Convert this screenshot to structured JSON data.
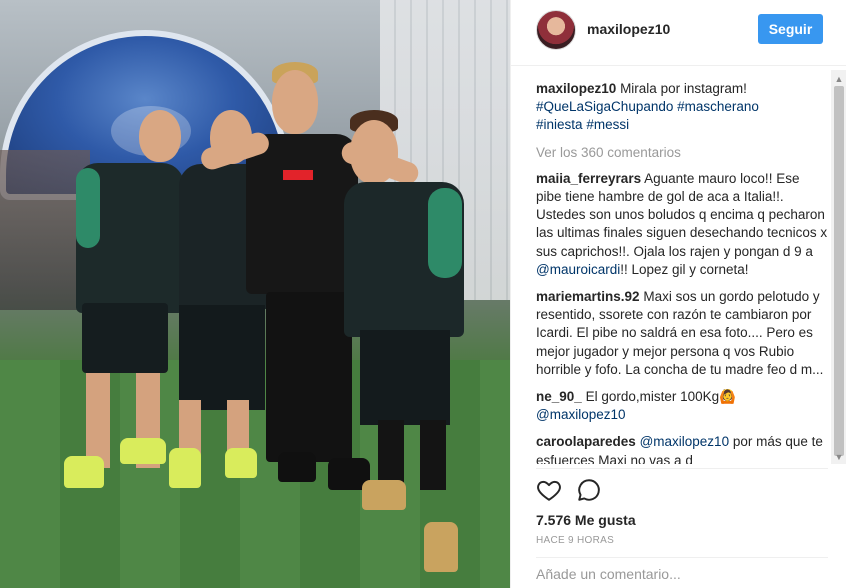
{
  "post": {
    "image_alt": "Four men posing on a football pitch",
    "author": "maxilopez10",
    "follow_label": "Seguir",
    "caption": {
      "user": "maxilopez10",
      "text": "Mirala por instagram!",
      "hashtags": [
        "#QueLaSigaChupando",
        "#mascherano",
        "#iniesta",
        "#messi"
      ]
    },
    "view_all_comments": "Ver los 360 comentarios",
    "comments": [
      {
        "user": "maiia_ferreyrars",
        "text_before": "Aguante mauro loco!! Ese pibe tiene hambre de gol de aca a Italia!!. Ustedes son unos boludos q encima q pecharon las ultimas finales siguen desechando tecnicos x sus caprichos!!. Ojala los rajen y pongan d 9 a ",
        "mention": "@mauroicardi",
        "text_after": "!! Lopez gil y corneta!"
      },
      {
        "user": "mariemartins.92",
        "text_before": "Maxi sos un gordo pelotudo y resentido, ssorete con razón te cambiaron por Icardi. El pibe no saldrá en esa foto.... Pero es mejor jugador y mejor persona q vos Rubio horrible y fofo. La concha de tu madre feo d m...",
        "mention": "",
        "text_after": ""
      },
      {
        "user": "ne_90_",
        "text_before": "El gordo,mister 100Kg🙆 ",
        "mention": "@maxilopez10",
        "text_after": ""
      },
      {
        "user": "caroolaparedes",
        "text_before": "",
        "mention": "@maxilopez10",
        "text_after": " por más que te esfuerces Maxi no vas a d"
      }
    ],
    "likes": "7.576 Me gusta",
    "time": "HACE 9 HORAS",
    "add_comment_placeholder": "Añade un comentario..."
  },
  "colors": {
    "follow_button": "#3897f0",
    "hashtag": "#003569",
    "muted": "#999999"
  },
  "icons": [
    "heart-icon",
    "comment-icon",
    "scroll-up-arrow",
    "scroll-down-arrow"
  ]
}
